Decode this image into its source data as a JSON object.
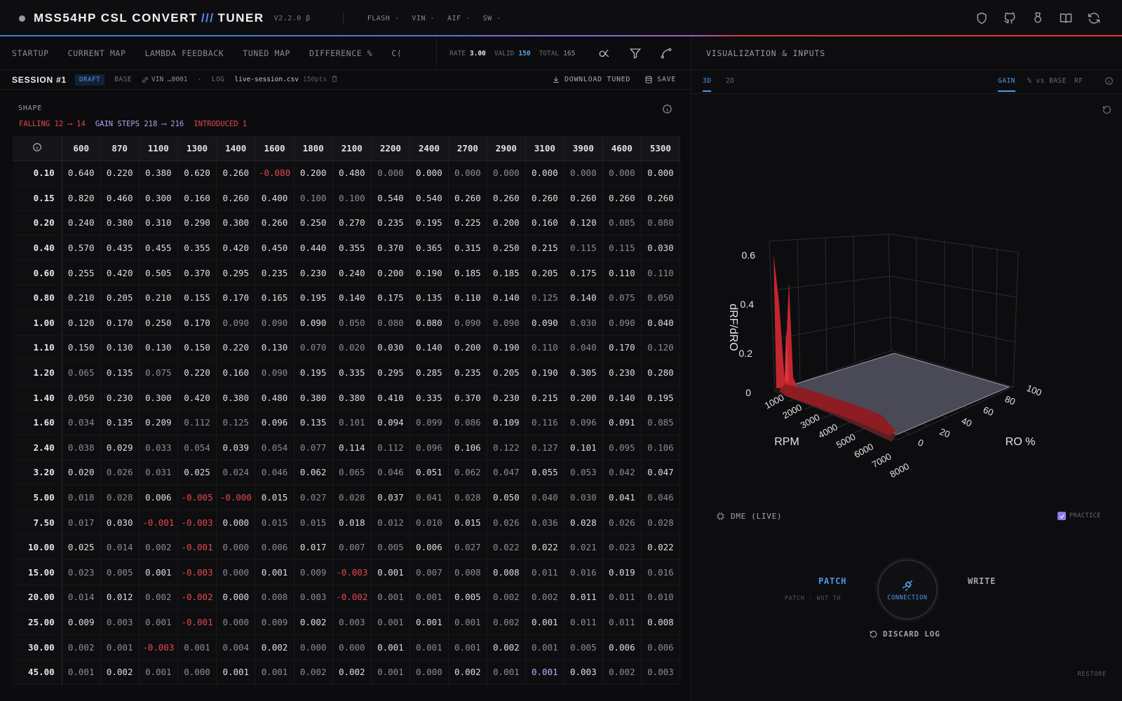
{
  "app": {
    "title_left": "MSS54HP CSL CONVERT",
    "title_slash": "///",
    "title_right": "TUNER",
    "version": "V2.2.0 β",
    "menus": [
      "FLASH -",
      "VIN -",
      "AIF -",
      "SW -"
    ],
    "icons": [
      "shield-icon",
      "github-icon",
      "award-icon",
      "book-icon",
      "refresh-icon"
    ]
  },
  "tabs": [
    "STARTUP",
    "CURRENT MAP",
    "LAMBDA FEEDBACK",
    "TUNED MAP",
    "DIFFERENCE %",
    "C("
  ],
  "stats": {
    "rate_label": "RATE",
    "rate_value": "3.00",
    "valid_label": "VALID",
    "valid_value": "150",
    "total_label": "TOTAL",
    "total_value": "165"
  },
  "session": {
    "title": "SESSION #1",
    "badge": "DRAFT",
    "base_label": "BASE",
    "vin": "VIN …0001",
    "sep": "·",
    "log_label": "LOG",
    "log_file": "live-session.csv",
    "log_pts": "150pts",
    "download": "DOWNLOAD TUNED",
    "save": "SAVE"
  },
  "shape": {
    "title": "SHAPE",
    "falling": "FALLING 12 ⟶ 14",
    "gain_steps": "GAIN STEPS 218 ⟶ 216",
    "introduced": "INTRODUCED 1"
  },
  "table": {
    "columns": [
      "600",
      "870",
      "1100",
      "1300",
      "1400",
      "1600",
      "1800",
      "2100",
      "2200",
      "2400",
      "2700",
      "2900",
      "3100",
      "3900",
      "4600",
      "5300"
    ],
    "rows": [
      {
        "label": "0.10",
        "cells": [
          "0.640",
          "0.220",
          "0.380",
          "0.620",
          "0.260",
          "-0.080",
          "0.200",
          "0.480",
          "0.000",
          "0.000",
          "0.000",
          "0.000",
          "0.000",
          "0.000",
          "0.000",
          "0.000"
        ]
      },
      {
        "label": "0.15",
        "cells": [
          "0.820",
          "0.460",
          "0.300",
          "0.160",
          "0.260",
          "0.400",
          "0.100",
          "0.100",
          "0.540",
          "0.540",
          "0.260",
          "0.260",
          "0.260",
          "0.260",
          "0.260",
          "0.260"
        ]
      },
      {
        "label": "0.20",
        "cells": [
          "0.240",
          "0.380",
          "0.310",
          "0.290",
          "0.300",
          "0.260",
          "0.250",
          "0.270",
          "0.235",
          "0.195",
          "0.225",
          "0.200",
          "0.160",
          "0.120",
          "0.085",
          "0.080"
        ]
      },
      {
        "label": "0.40",
        "cells": [
          "0.570",
          "0.435",
          "0.455",
          "0.355",
          "0.420",
          "0.450",
          "0.440",
          "0.355",
          "0.370",
          "0.365",
          "0.315",
          "0.250",
          "0.215",
          "0.115",
          "0.115",
          "0.030"
        ]
      },
      {
        "label": "0.60",
        "cells": [
          "0.255",
          "0.420",
          "0.505",
          "0.370",
          "0.295",
          "0.235",
          "0.230",
          "0.240",
          "0.200",
          "0.190",
          "0.185",
          "0.185",
          "0.205",
          "0.175",
          "0.110",
          "0.110"
        ]
      },
      {
        "label": "0.80",
        "cells": [
          "0.210",
          "0.205",
          "0.210",
          "0.155",
          "0.170",
          "0.165",
          "0.195",
          "0.140",
          "0.175",
          "0.135",
          "0.110",
          "0.140",
          "0.125",
          "0.140",
          "0.075",
          "0.050"
        ]
      },
      {
        "label": "1.00",
        "cells": [
          "0.120",
          "0.170",
          "0.250",
          "0.170",
          "0.090",
          "0.090",
          "0.090",
          "0.050",
          "0.080",
          "0.080",
          "0.090",
          "0.090",
          "0.090",
          "0.030",
          "0.090",
          "0.040"
        ]
      },
      {
        "label": "1.10",
        "cells": [
          "0.150",
          "0.130",
          "0.130",
          "0.150",
          "0.220",
          "0.130",
          "0.070",
          "0.020",
          "0.030",
          "0.140",
          "0.200",
          "0.190",
          "0.110",
          "0.040",
          "0.170",
          "0.120"
        ]
      },
      {
        "label": "1.20",
        "cells": [
          "0.065",
          "0.135",
          "0.075",
          "0.220",
          "0.160",
          "0.090",
          "0.195",
          "0.335",
          "0.295",
          "0.285",
          "0.235",
          "0.205",
          "0.190",
          "0.305",
          "0.230",
          "0.280"
        ]
      },
      {
        "label": "1.40",
        "cells": [
          "0.050",
          "0.230",
          "0.300",
          "0.420",
          "0.380",
          "0.480",
          "0.380",
          "0.380",
          "0.410",
          "0.335",
          "0.370",
          "0.230",
          "0.215",
          "0.200",
          "0.140",
          "0.195"
        ]
      },
      {
        "label": "1.60",
        "cells": [
          "0.034",
          "0.135",
          "0.209",
          "0.112",
          "0.125",
          "0.096",
          "0.135",
          "0.101",
          "0.094",
          "0.099",
          "0.086",
          "0.109",
          "0.116",
          "0.096",
          "0.091",
          "0.085"
        ]
      },
      {
        "label": "2.40",
        "cells": [
          "0.038",
          "0.029",
          "0.033",
          "0.054",
          "0.039",
          "0.054",
          "0.077",
          "0.114",
          "0.112",
          "0.096",
          "0.106",
          "0.122",
          "0.127",
          "0.101",
          "0.095",
          "0.106"
        ]
      },
      {
        "label": "3.20",
        "cells": [
          "0.020",
          "0.026",
          "0.031",
          "0.025",
          "0.024",
          "0.046",
          "0.062",
          "0.065",
          "0.046",
          "0.051",
          "0.062",
          "0.047",
          "0.055",
          "0.053",
          "0.042",
          "0.047"
        ]
      },
      {
        "label": "5.00",
        "cells": [
          "0.018",
          "0.028",
          "0.006",
          "-0.005",
          "-0.000",
          "0.015",
          "0.027",
          "0.028",
          "0.037",
          "0.041",
          "0.028",
          "0.050",
          "0.040",
          "0.030",
          "0.041",
          "0.046"
        ]
      },
      {
        "label": "7.50",
        "cells": [
          "0.017",
          "0.030",
          "-0.001",
          "-0.003",
          "0.000",
          "0.015",
          "0.015",
          "0.018",
          "0.012",
          "0.010",
          "0.015",
          "0.026",
          "0.036",
          "0.028",
          "0.026",
          "0.028"
        ]
      },
      {
        "label": "10.00",
        "cells": [
          "0.025",
          "0.014",
          "0.002",
          "-0.001",
          "0.000",
          "0.006",
          "0.017",
          "0.007",
          "0.005",
          "0.006",
          "0.027",
          "0.022",
          "0.022",
          "0.021",
          "0.023",
          "0.022"
        ]
      },
      {
        "label": "15.00",
        "cells": [
          "0.023",
          "0.005",
          "0.001",
          "-0.003",
          "0.000",
          "0.001",
          "0.009",
          "-0.003",
          "0.001",
          "0.007",
          "0.008",
          "0.008",
          "0.011",
          "0.016",
          "0.019",
          "0.016"
        ]
      },
      {
        "label": "20.00",
        "cells": [
          "0.014",
          "0.012",
          "0.002",
          "-0.002",
          "0.000",
          "0.008",
          "0.003",
          "-0.002",
          "0.001",
          "0.001",
          "0.005",
          "0.002",
          "0.002",
          "0.011",
          "0.011",
          "0.010"
        ]
      },
      {
        "label": "25.00",
        "cells": [
          "0.009",
          "0.003",
          "0.001",
          "-0.001",
          "0.000",
          "0.009",
          "0.002",
          "0.003",
          "0.001",
          "0.001",
          "0.001",
          "0.002",
          "0.001",
          "0.011",
          "0.011",
          "0.008"
        ]
      },
      {
        "label": "30.00",
        "cells": [
          "0.002",
          "0.001",
          "-0.003",
          "0.001",
          "0.004",
          "0.002",
          "0.000",
          "0.000",
          "0.001",
          "0.001",
          "0.001",
          "0.002",
          "0.001",
          "0.005",
          "0.006",
          "0.006"
        ]
      },
      {
        "label": "45.00",
        "cells": [
          "0.001",
          "0.002",
          "0.001",
          "0.000",
          "0.001",
          "0.001",
          "0.002",
          "0.002",
          "0.001",
          "0.000",
          "0.002",
          "0.001",
          "0.001",
          "0.003",
          "0.002",
          "0.003"
        ]
      }
    ]
  },
  "viz": {
    "title": "VISUALIZATION & INPUTS",
    "tab_3d": "3D",
    "tab_2d": "2D",
    "mode_gain": "GAIN",
    "mode_pct": "% vs BASE",
    "mode_rf": "RF",
    "zlabel": "dRF/dRO",
    "xlabel": "RPM",
    "ylabel": "RO %",
    "z_ticks": [
      "0.6",
      "0.4",
      "0.2",
      "0"
    ],
    "rpm_ticks": [
      "1000",
      "2000",
      "3000",
      "4000",
      "5000",
      "6000",
      "7000",
      "8000"
    ],
    "ro_ticks": [
      "100",
      "80",
      "60",
      "40",
      "20",
      "0"
    ]
  },
  "controls": {
    "dme": "DME (LIVE)",
    "practice": "PRACTICE",
    "patch": "PATCH",
    "patch_sub": "PATCH · WOT TH",
    "connection": "CONNECTION",
    "write": "WRITE",
    "discard": "DISCARD LOG",
    "restore": "RESTORE"
  },
  "colors": {
    "accent": "#4f9ae6",
    "negative": "#e5484d",
    "purple": "#a9a4f5"
  }
}
